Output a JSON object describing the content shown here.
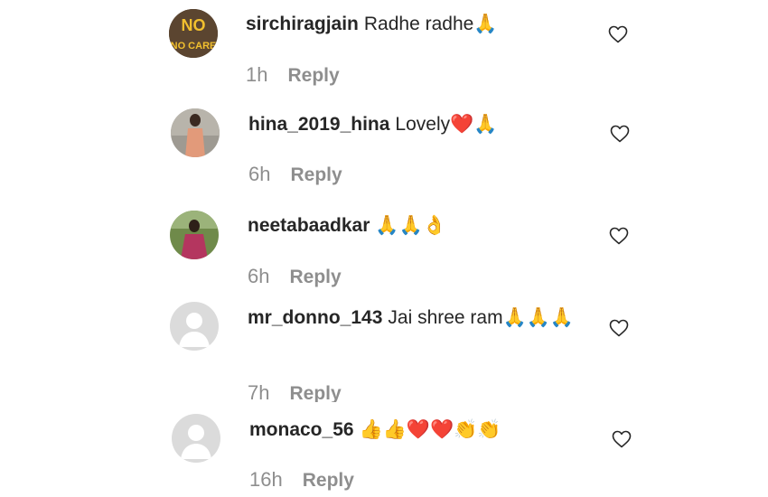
{
  "comments": [
    {
      "username": "sirchiragjain",
      "text": "Radhe radhe🙏",
      "time": "1h",
      "reply": "Reply",
      "avatar_text": "NO CARE"
    },
    {
      "username": "hina_2019_hina",
      "text": "Lovely❤️🙏",
      "time": "6h",
      "reply": "Reply"
    },
    {
      "username": "neetabaadkar",
      "text": "🙏🙏👌",
      "time": "6h",
      "reply": "Reply"
    },
    {
      "username": "mr_donno_143",
      "text": "Jai shree ram🙏🙏🙏",
      "time": "7h",
      "reply": "Reply"
    },
    {
      "username": "monaco_56",
      "text": "👍👍❤️❤️👏👏",
      "time": "16h",
      "reply": "Reply"
    }
  ],
  "icons": {
    "like": "heart-outline-icon",
    "default_avatar": "default-avatar-icon"
  },
  "colors": {
    "text": "#262626",
    "meta": "#8e8e8e",
    "avatar_bg": "#dbdbdb"
  }
}
